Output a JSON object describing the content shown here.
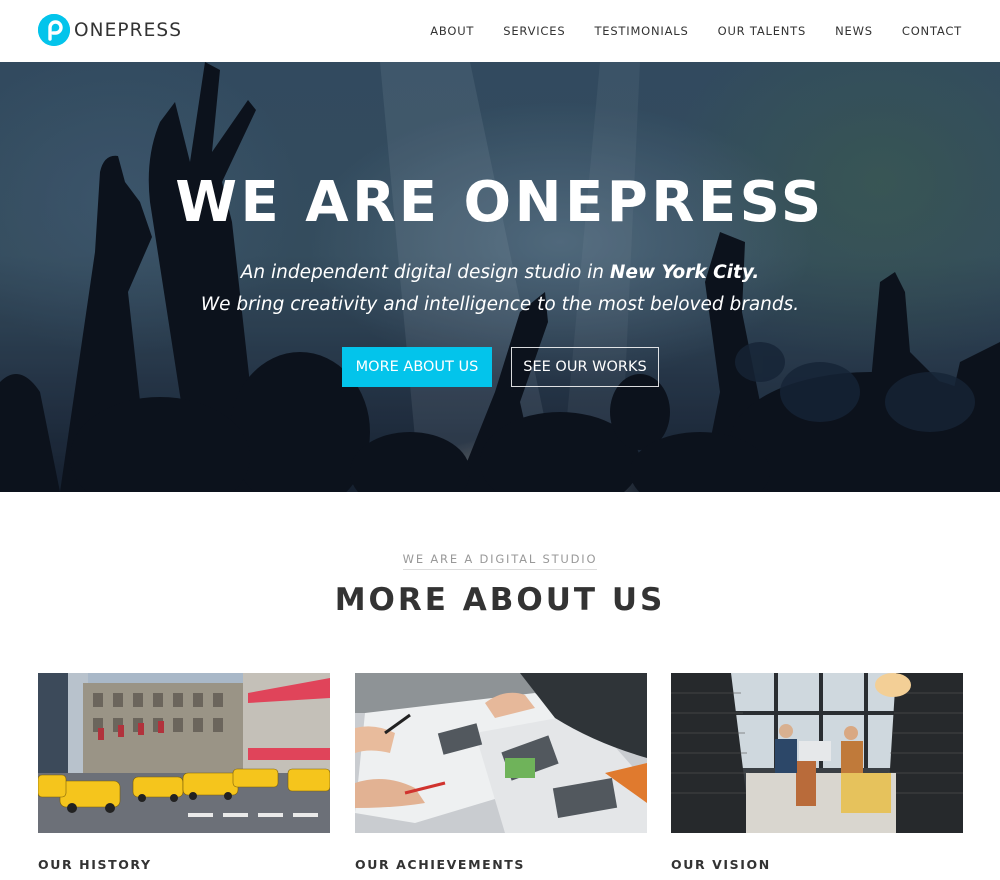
{
  "brand": {
    "name": "ONEPRESS",
    "accent": "#03c4eb"
  },
  "nav": {
    "items": [
      "ABOUT",
      "SERVICES",
      "TESTIMONIALS",
      "OUR TALENTS",
      "NEWS",
      "CONTACT"
    ]
  },
  "hero": {
    "title": "WE ARE ONEPRESS",
    "subtitle_line1_prefix": "An independent digital design studio in ",
    "subtitle_line1_emphasis": "New York City.",
    "subtitle_line2": "We bring creativity and intelligence to the most beloved brands.",
    "primary_button": "MORE ABOUT US",
    "secondary_button": "SEE OUR WORKS"
  },
  "about": {
    "subtitle": "WE ARE A DIGITAL STUDIO",
    "title": "MORE ABOUT US",
    "cards": [
      {
        "title": "OUR HISTORY",
        "image": "city-taxi-street"
      },
      {
        "title": "OUR ACHIEVEMENTS",
        "image": "design-desk-hands"
      },
      {
        "title": "OUR VISION",
        "image": "office-meeting-pod"
      }
    ]
  }
}
